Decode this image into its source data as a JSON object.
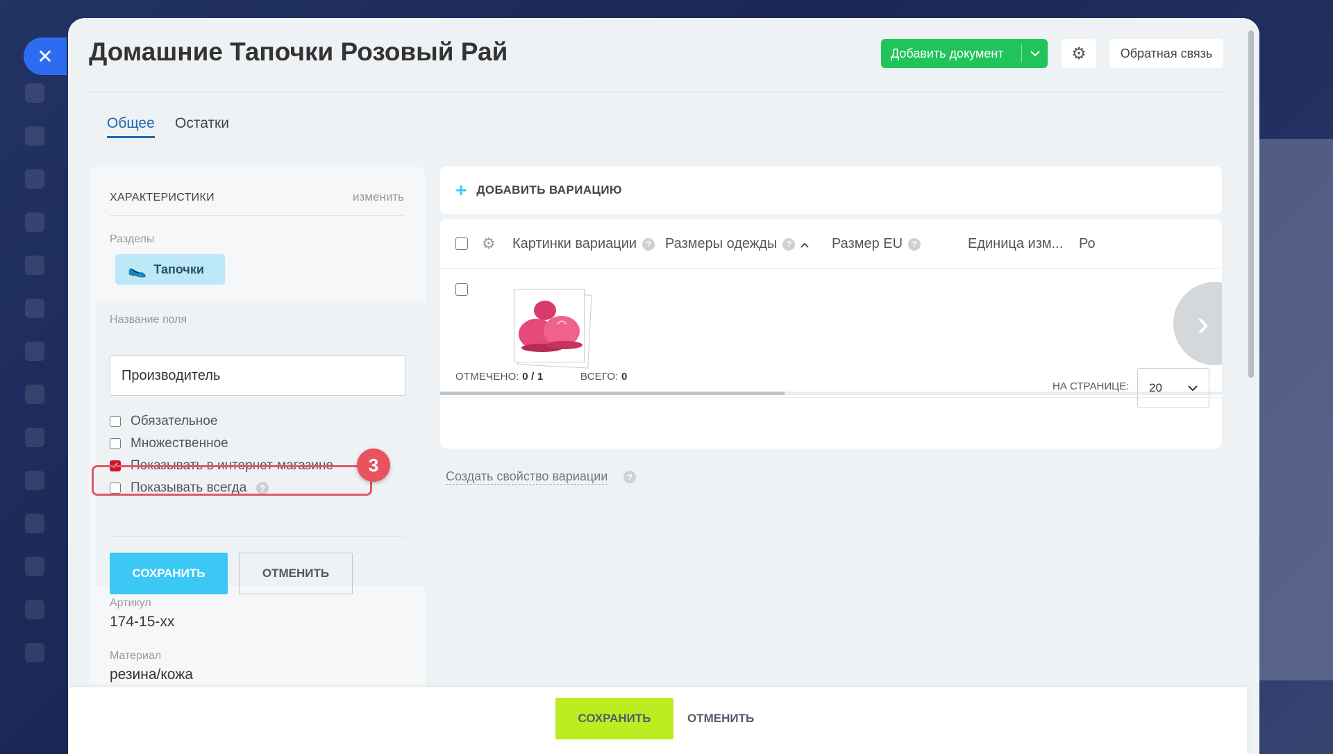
{
  "page": {
    "title": "Домашние Тапочки Розовый Рай",
    "close_icon": "close-icon"
  },
  "header": {
    "add_document": "Добавить документ",
    "feedback": "Обратная связь"
  },
  "tabs": [
    {
      "label": "Общее",
      "active": true
    },
    {
      "label": "Остатки",
      "active": false
    }
  ],
  "left_panel": {
    "heading": "ХАРАКТЕРИСТИКИ",
    "edit_link": "изменить",
    "sections_label": "Разделы",
    "section_chip": "Тапочки",
    "field_name_label": "Название поля",
    "field_name_value": "Производитель",
    "checkboxes": [
      {
        "label": "Обязательное",
        "checked": false
      },
      {
        "label": "Множественное",
        "checked": false
      },
      {
        "label": "Показывать в интернет-магазине",
        "checked": true
      },
      {
        "label": "Показывать всегда",
        "checked": false
      }
    ],
    "badge": "3",
    "save": "СОХРАНИТЬ",
    "cancel": "ОТМЕНИТЬ",
    "article_label": "Артикул",
    "article_value": "174-15-xx",
    "material_label": "Материал",
    "material_value": "резина/кожа"
  },
  "variations": {
    "add_label": "ДОБАВИТЬ ВАРИАЦИЮ",
    "columns": [
      "Картинки вариации",
      "Размеры одежды",
      "Размер EU",
      "Единица изм...",
      "Ро"
    ],
    "selected_label": "ОТМЕЧЕНО:",
    "selected_value": "0 / 1",
    "total_label": "ВСЕГО:",
    "total_value": "0",
    "per_page_label": "НА СТРАНИЦЕ:",
    "per_page_value": "20",
    "create_property": "Создать свойство вариации"
  },
  "footer": {
    "save": "СОХРАНИТЬ",
    "cancel": "ОТМЕНИТЬ"
  },
  "colors": {
    "accent_blue": "#2067b0",
    "green": "#21c45b",
    "lime": "#bbed21",
    "cyan": "#3bc8f5",
    "highlight": "#e05763"
  }
}
